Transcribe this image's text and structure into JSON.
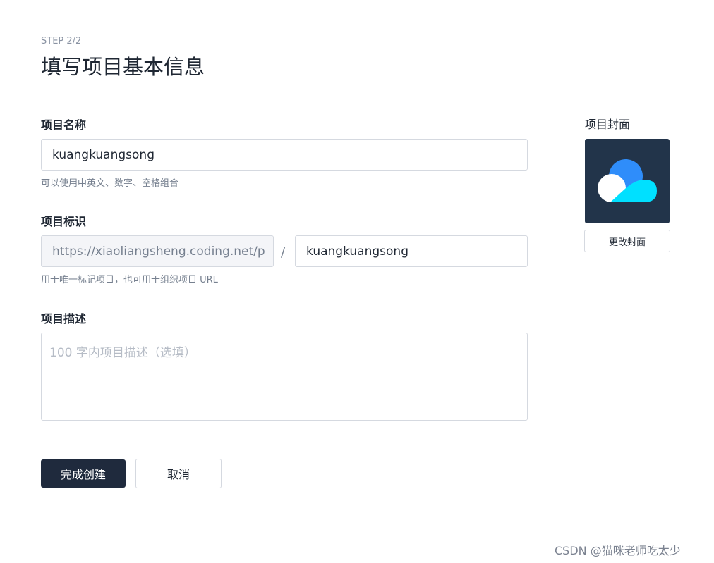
{
  "header": {
    "step": "STEP 2/2",
    "title": "填写项目基本信息"
  },
  "form": {
    "name": {
      "label": "项目名称",
      "value": "kuangkuangsong",
      "hint": "可以使用中英文、数字、空格组合"
    },
    "identifier": {
      "label": "项目标识",
      "prefix": "https://xiaoliangsheng.coding.net/p",
      "separator": "/",
      "value": "kuangkuangsong",
      "hint": "用于唯一标记项目，也可用于组织项目 URL"
    },
    "description": {
      "label": "项目描述",
      "placeholder": "100 字内项目描述（选填）"
    }
  },
  "cover": {
    "label": "项目封面",
    "icon": "cloud-icon",
    "change_label": "更改封面"
  },
  "actions": {
    "submit_label": "完成创建",
    "cancel_label": "取消"
  },
  "watermark": "CSDN @猫咪老师吃太少",
  "colors": {
    "primary": "#1f2a3d",
    "cover_bg": "#22344a",
    "cloud_blue": "#2f8dfa",
    "cloud_cyan": "#00e0ff"
  }
}
